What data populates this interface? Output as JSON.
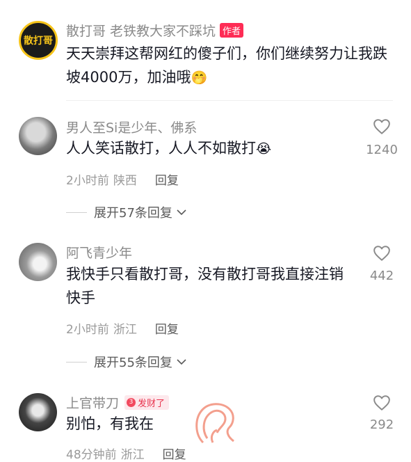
{
  "author_comment": {
    "avatar_text": "散打哥",
    "username": "散打哥 老铁教大家不踩坑",
    "author_badge": "作者",
    "text": "天天崇拜这帮网红的傻子们，你们继续努力让我跌坡4000万，加油哦",
    "emoji": "🤭"
  },
  "comments": [
    {
      "username": "男人至Si是少年、佛系",
      "text": "人人笑话散打，人人不如散打",
      "emoji": "😭",
      "time": "2小时前",
      "location": "陕西",
      "reply_label": "回复",
      "likes": "1240",
      "expand_label": "展开57条回复"
    },
    {
      "username": "阿飞青少年",
      "text": "我快手只看散打哥，没有散打哥我直接注销快手",
      "time": "2小时前",
      "location": "浙江",
      "reply_label": "回复",
      "likes": "442",
      "expand_label": "展开55条回复"
    },
    {
      "username": "上官带刀",
      "fortune_badge_level": "3",
      "fortune_badge": "发财了",
      "text": "别怕，有我在",
      "time": "48分钟前",
      "location": "浙江",
      "reply_label": "回复",
      "likes": "292"
    }
  ],
  "colors": {
    "author_badge": "#fe2c55",
    "avatar_ring": "#f6c41a",
    "watermark": "#f07f68"
  }
}
